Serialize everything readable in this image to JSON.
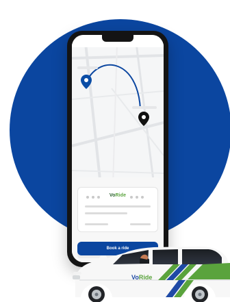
{
  "phone": {
    "card": {
      "brand_prefix": "Vo",
      "brand_suffix": "Ride"
    },
    "book_button_label": "Book a ride"
  },
  "vehicle": {
    "brand_prefix": "Vo",
    "brand_suffix": "Ride"
  },
  "colors": {
    "circle": "#0b46a0",
    "route": "#0b46a0",
    "origin_pin": "#0b4da6",
    "destination_pin": "#111111",
    "button": "#0b46a0",
    "car_green": "#5aa33d",
    "car_blue": "#1f4aa5",
    "car_body": "#f7f7f7"
  },
  "icons": {
    "origin": "location-pin-icon",
    "destination": "location-pin-icon",
    "vehicle": "minivan-illustration"
  }
}
